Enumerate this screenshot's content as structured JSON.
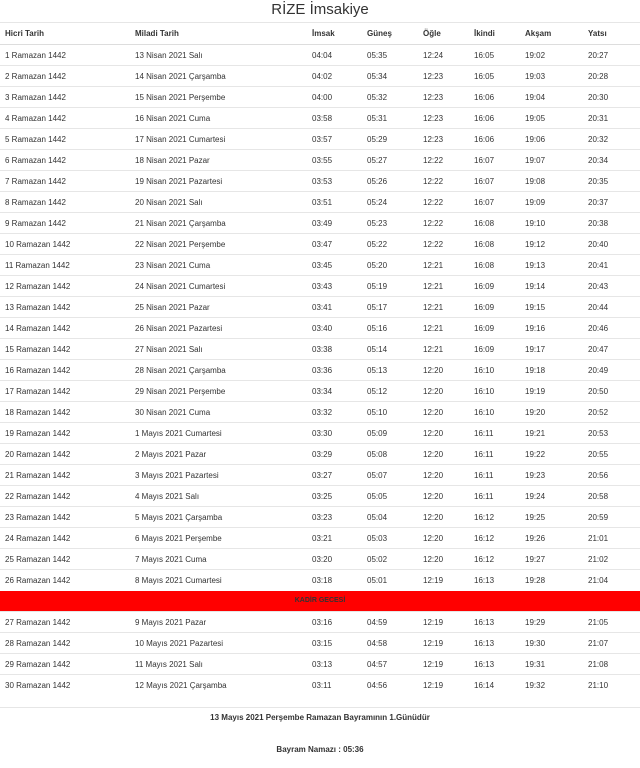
{
  "title": "RİZE İmsakiye",
  "columns": [
    "Hicri Tarih",
    "Miladi Tarih",
    "İmsak",
    "Güneş",
    "Öğle",
    "İkindi",
    "Akşam",
    "Yatsı"
  ],
  "rows_before": [
    [
      "1 Ramazan 1442",
      "13 Nisan 2021 Salı",
      "04:04",
      "05:35",
      "12:24",
      "16:05",
      "19:02",
      "20:27"
    ],
    [
      "2 Ramazan 1442",
      "14 Nisan 2021 Çarşamba",
      "04:02",
      "05:34",
      "12:23",
      "16:05",
      "19:03",
      "20:28"
    ],
    [
      "3 Ramazan 1442",
      "15 Nisan 2021 Perşembe",
      "04:00",
      "05:32",
      "12:23",
      "16:06",
      "19:04",
      "20:30"
    ],
    [
      "4 Ramazan 1442",
      "16 Nisan 2021 Cuma",
      "03:58",
      "05:31",
      "12:23",
      "16:06",
      "19:05",
      "20:31"
    ],
    [
      "5 Ramazan 1442",
      "17 Nisan 2021 Cumartesi",
      "03:57",
      "05:29",
      "12:23",
      "16:06",
      "19:06",
      "20:32"
    ],
    [
      "6 Ramazan 1442",
      "18 Nisan 2021 Pazar",
      "03:55",
      "05:27",
      "12:22",
      "16:07",
      "19:07",
      "20:34"
    ],
    [
      "7 Ramazan 1442",
      "19 Nisan 2021 Pazartesi",
      "03:53",
      "05:26",
      "12:22",
      "16:07",
      "19:08",
      "20:35"
    ],
    [
      "8 Ramazan 1442",
      "20 Nisan 2021 Salı",
      "03:51",
      "05:24",
      "12:22",
      "16:07",
      "19:09",
      "20:37"
    ],
    [
      "9 Ramazan 1442",
      "21 Nisan 2021 Çarşamba",
      "03:49",
      "05:23",
      "12:22",
      "16:08",
      "19:10",
      "20:38"
    ],
    [
      "10 Ramazan 1442",
      "22 Nisan 2021 Perşembe",
      "03:47",
      "05:22",
      "12:22",
      "16:08",
      "19:12",
      "20:40"
    ],
    [
      "11 Ramazan 1442",
      "23 Nisan 2021 Cuma",
      "03:45",
      "05:20",
      "12:21",
      "16:08",
      "19:13",
      "20:41"
    ],
    [
      "12 Ramazan 1442",
      "24 Nisan 2021 Cumartesi",
      "03:43",
      "05:19",
      "12:21",
      "16:09",
      "19:14",
      "20:43"
    ],
    [
      "13 Ramazan 1442",
      "25 Nisan 2021 Pazar",
      "03:41",
      "05:17",
      "12:21",
      "16:09",
      "19:15",
      "20:44"
    ],
    [
      "14 Ramazan 1442",
      "26 Nisan 2021 Pazartesi",
      "03:40",
      "05:16",
      "12:21",
      "16:09",
      "19:16",
      "20:46"
    ],
    [
      "15 Ramazan 1442",
      "27 Nisan 2021 Salı",
      "03:38",
      "05:14",
      "12:21",
      "16:09",
      "19:17",
      "20:47"
    ],
    [
      "16 Ramazan 1442",
      "28 Nisan 2021 Çarşamba",
      "03:36",
      "05:13",
      "12:20",
      "16:10",
      "19:18",
      "20:49"
    ],
    [
      "17 Ramazan 1442",
      "29 Nisan 2021 Perşembe",
      "03:34",
      "05:12",
      "12:20",
      "16:10",
      "19:19",
      "20:50"
    ],
    [
      "18 Ramazan 1442",
      "30 Nisan 2021 Cuma",
      "03:32",
      "05:10",
      "12:20",
      "16:10",
      "19:20",
      "20:52"
    ],
    [
      "19 Ramazan 1442",
      "1 Mayıs 2021 Cumartesi",
      "03:30",
      "05:09",
      "12:20",
      "16:11",
      "19:21",
      "20:53"
    ],
    [
      "20 Ramazan 1442",
      "2 Mayıs 2021 Pazar",
      "03:29",
      "05:08",
      "12:20",
      "16:11",
      "19:22",
      "20:55"
    ],
    [
      "21 Ramazan 1442",
      "3 Mayıs 2021 Pazartesi",
      "03:27",
      "05:07",
      "12:20",
      "16:11",
      "19:23",
      "20:56"
    ],
    [
      "22 Ramazan 1442",
      "4 Mayıs 2021 Salı",
      "03:25",
      "05:05",
      "12:20",
      "16:11",
      "19:24",
      "20:58"
    ],
    [
      "23 Ramazan 1442",
      "5 Mayıs 2021 Çarşamba",
      "03:23",
      "05:04",
      "12:20",
      "16:12",
      "19:25",
      "20:59"
    ],
    [
      "24 Ramazan 1442",
      "6 Mayıs 2021 Perşembe",
      "03:21",
      "05:03",
      "12:20",
      "16:12",
      "19:26",
      "21:01"
    ],
    [
      "25 Ramazan 1442",
      "7 Mayıs 2021 Cuma",
      "03:20",
      "05:02",
      "12:20",
      "16:12",
      "19:27",
      "21:02"
    ],
    [
      "26 Ramazan 1442",
      "8 Mayıs 2021 Cumartesi",
      "03:18",
      "05:01",
      "12:19",
      "16:13",
      "19:28",
      "21:04"
    ]
  ],
  "special_row": {
    "label": "KADİR GECESİ",
    "color": "#ff0000"
  },
  "rows_after": [
    [
      "27 Ramazan 1442",
      "9 Mayıs 2021 Pazar",
      "03:16",
      "04:59",
      "12:19",
      "16:13",
      "19:29",
      "21:05"
    ],
    [
      "28 Ramazan 1442",
      "10 Mayıs 2021 Pazartesi",
      "03:15",
      "04:58",
      "12:19",
      "16:13",
      "19:30",
      "21:07"
    ],
    [
      "29 Ramazan 1442",
      "11 Mayıs 2021 Salı",
      "03:13",
      "04:57",
      "12:19",
      "16:13",
      "19:31",
      "21:08"
    ],
    [
      "30 Ramazan 1442",
      "12 Mayıs 2021 Çarşamba",
      "03:11",
      "04:56",
      "12:19",
      "16:14",
      "19:32",
      "21:10"
    ]
  ],
  "footer": {
    "bayram_line": "13 Mayıs 2021 Perşembe Ramazan Bayramının 1.Günüdür",
    "namaz_line": "Bayram Namazı : 05:36"
  }
}
